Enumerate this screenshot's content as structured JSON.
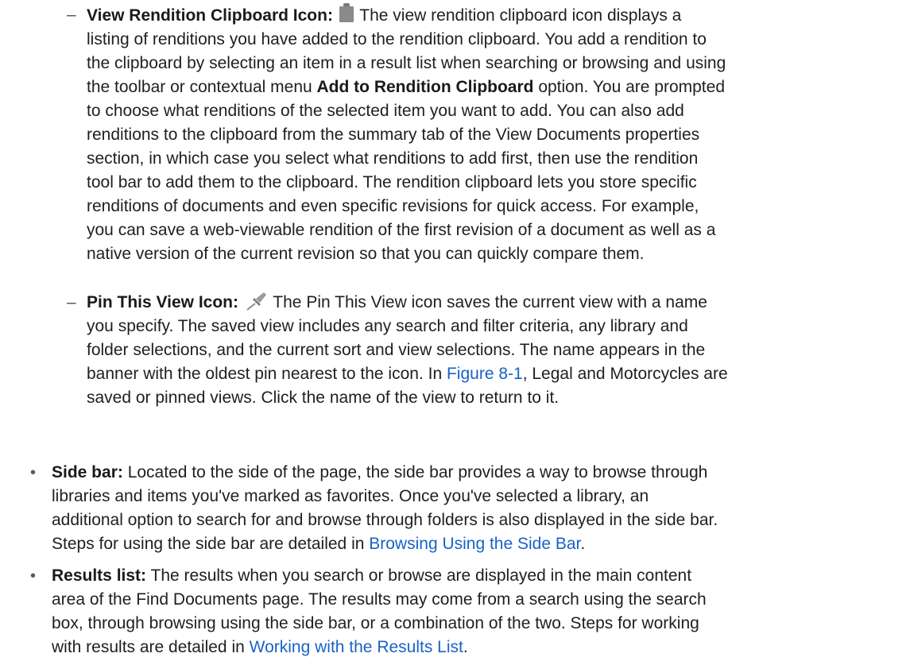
{
  "sub_items": [
    {
      "marker": "–",
      "term": "View Rendition Clipboard Icon:",
      "icon": "clipboard-icon",
      "lines": [
        {
          "segs": [
            {
              "t": "The view rendition clipboard icon displays a"
            }
          ]
        },
        {
          "segs": [
            {
              "t": "listing of renditions you have added to the rendition clipboard. You add a rendition to"
            }
          ]
        },
        {
          "segs": [
            {
              "t": "the clipboard by selecting an item in a result list when searching or browsing and using"
            }
          ]
        },
        {
          "segs": [
            {
              "t": "the toolbar or contextual menu "
            },
            {
              "b": "Add to Rendition Clipboard"
            },
            {
              "t": " option. You are prompted"
            }
          ]
        },
        {
          "segs": [
            {
              "t": "to choose what renditions of the selected item you want to add. You can also add"
            }
          ]
        },
        {
          "segs": [
            {
              "t": "renditions to the clipboard from the summary tab of the View Documents properties"
            }
          ]
        },
        {
          "segs": [
            {
              "t": "section, in which case you select what renditions to add first, then use the rendition"
            }
          ]
        },
        {
          "segs": [
            {
              "t": "tool bar to add them to the clipboard. The rendition clipboard lets you store specific"
            }
          ]
        },
        {
          "segs": [
            {
              "t": "renditions of documents and even specific revisions for quick access. For example,"
            }
          ]
        },
        {
          "segs": [
            {
              "t": "you can save a web-viewable rendition of the first revision of a document as well as a"
            }
          ]
        },
        {
          "segs": [
            {
              "t": "native version of the current revision so that you can quickly compare them."
            }
          ]
        }
      ]
    },
    {
      "marker": "–",
      "term": "Pin This View Icon:",
      "icon": "pin-icon",
      "lines": [
        {
          "segs": [
            {
              "t": "The Pin This View icon saves the current view with a name"
            }
          ]
        },
        {
          "segs": [
            {
              "t": "you specify. The saved view includes any search and filter criteria, any library and"
            }
          ]
        },
        {
          "segs": [
            {
              "t": "folder selections, and the current sort and view selections. The name appears in the"
            }
          ]
        },
        {
          "segs": [
            {
              "t": "banner with the oldest pin nearest to the icon. In "
            },
            {
              "a": "Figure 8-1"
            },
            {
              "t": ", Legal and Motorcycles are"
            }
          ]
        },
        {
          "segs": [
            {
              "t": "saved or pinned views. Click the name of the view to return to it."
            }
          ]
        }
      ]
    }
  ],
  "bullet_items": [
    {
      "marker": "•",
      "term": "Side bar:",
      "lines": [
        {
          "segs": [
            {
              "t": "Located to the side of the page, the side bar provides a way to browse through"
            }
          ]
        },
        {
          "segs": [
            {
              "t": "libraries and items you've marked as favorites. Once you've selected a library, an"
            }
          ]
        },
        {
          "segs": [
            {
              "t": "additional option to search for and browse through folders is also displayed in the side bar."
            }
          ]
        },
        {
          "segs": [
            {
              "t": "Steps for using the side bar are detailed in "
            },
            {
              "a": "Browsing Using the Side Bar"
            },
            {
              "t": "."
            }
          ]
        }
      ]
    },
    {
      "marker": "•",
      "term": "Results list:",
      "lines": [
        {
          "segs": [
            {
              "t": "The results when you search or browse are displayed in the main content"
            }
          ]
        },
        {
          "segs": [
            {
              "t": "area of the Find Documents page. The results may come from a search using the search"
            }
          ]
        },
        {
          "segs": [
            {
              "t": "box, through browsing using the side bar, or a combination of the two. Steps for working"
            }
          ]
        },
        {
          "segs": [
            {
              "t": "with results are detailed in "
            },
            {
              "a": "Working with the Results List"
            },
            {
              "t": "."
            }
          ]
        }
      ]
    }
  ],
  "colors": {
    "text": "#1f1f1f",
    "link": "#1863c7",
    "marker": "#5a5a5a"
  }
}
